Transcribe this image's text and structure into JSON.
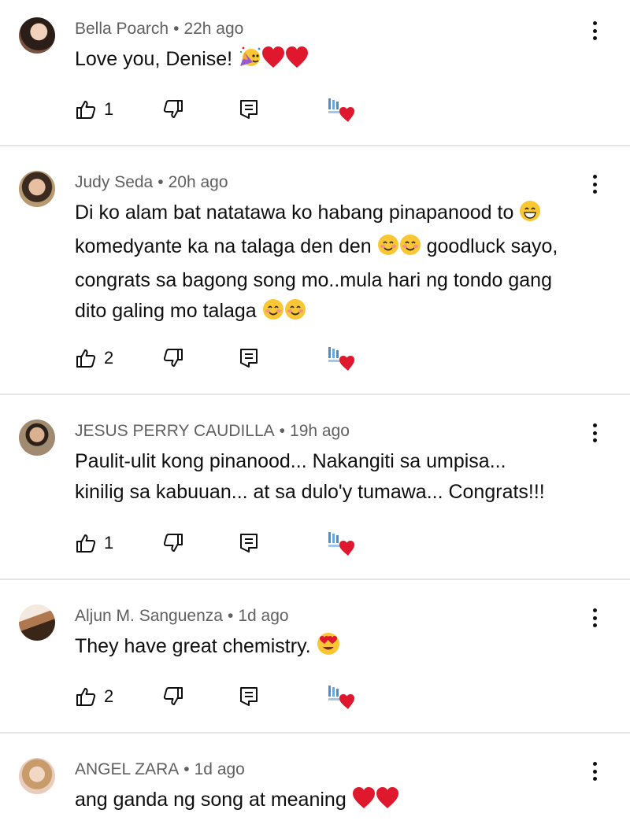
{
  "comments": [
    {
      "author": "Bella Poarch",
      "time": "22h ago",
      "text_lines": [
        "Love you, Denise! "
      ],
      "emojis": [
        "party-face",
        "red-heart",
        "red-heart"
      ],
      "likes": "1",
      "avatar_color": "#6b4a3a"
    },
    {
      "author": "Judy Seda",
      "time": "20h ago",
      "text_lines": [
        "Di ko alam bat natatawa ko habang pinapanood to ",
        "komedyante ka na talaga den den ",
        " goodluck sayo,",
        "congrats sa bagong song mo..mula hari ng tondo gang",
        "dito galing mo talaga "
      ],
      "likes": "2",
      "avatar_color": "#8a6a50"
    },
    {
      "author": "JESUS PERRY CAUDILLA",
      "time": "19h ago",
      "text_lines": [
        "Paulit-ulit kong pinanood... Nakangiti sa umpisa...",
        "kinilig sa kabuuan... at sa dulo'y tumawa... Congrats!!!"
      ],
      "likes": "1",
      "avatar_color": "#7c6a55"
    },
    {
      "author": "Aljun M. Sanguenza",
      "time": "1d ago",
      "text_lines": [
        "They have great chemistry. "
      ],
      "likes": "2",
      "avatar_color": "#5a4030"
    },
    {
      "author": "ANGEL ZARA",
      "time": "1d ago",
      "text_lines": [
        "ang ganda ng song at meaning "
      ],
      "likes": "",
      "avatar_color": "#d9b8a8"
    }
  ],
  "separator": "•",
  "colors": {
    "meta_text": "#606060",
    "body_text": "#0f0f0f",
    "divider": "#e5e5e5",
    "heart_red": "#e0182d",
    "emoji_yellow": "#f9c634"
  },
  "icons": {
    "like": "thumbs-up-icon",
    "dislike": "thumbs-down-icon",
    "reply": "reply-icon",
    "creator_heart": "creator-heart-icon",
    "more": "more-vert-icon"
  }
}
